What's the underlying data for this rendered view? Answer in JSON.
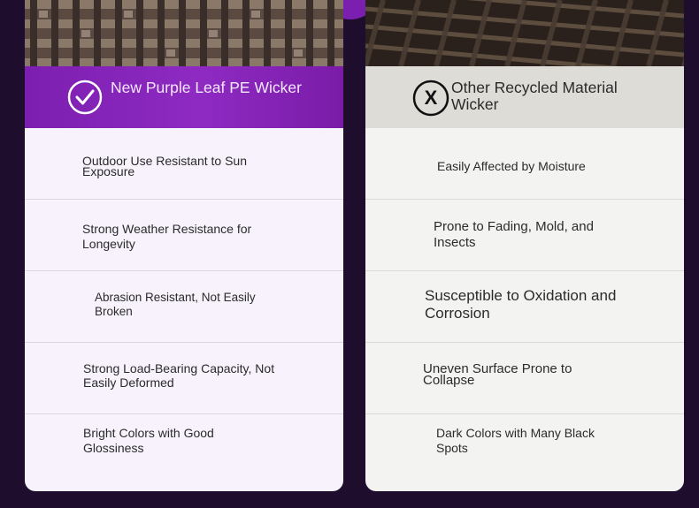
{
  "left": {
    "title": "New Purple Leaf PE Wicker",
    "icon": "check-circle-icon",
    "accent": "#8e2ac2",
    "rows": [
      "Outdoor Use Resistant to Sun Exposure",
      "Strong Weather Resistance for Longevity",
      "Abrasion Resistant, Not Easily Broken",
      "Strong Load-Bearing Capacity, Not Easily Deformed",
      "Bright Colors with Good Glossiness"
    ]
  },
  "right": {
    "title": "Other Recycled Material Wicker",
    "icon": "x-circle-icon",
    "rows": [
      "Easily Affected by Moisture",
      "Prone to Fading, Mold, and Insects",
      "Susceptible to Oxidation and Corrosion",
      "Uneven Surface Prone to Collapse",
      "Dark Colors with Many Black Spots"
    ]
  }
}
